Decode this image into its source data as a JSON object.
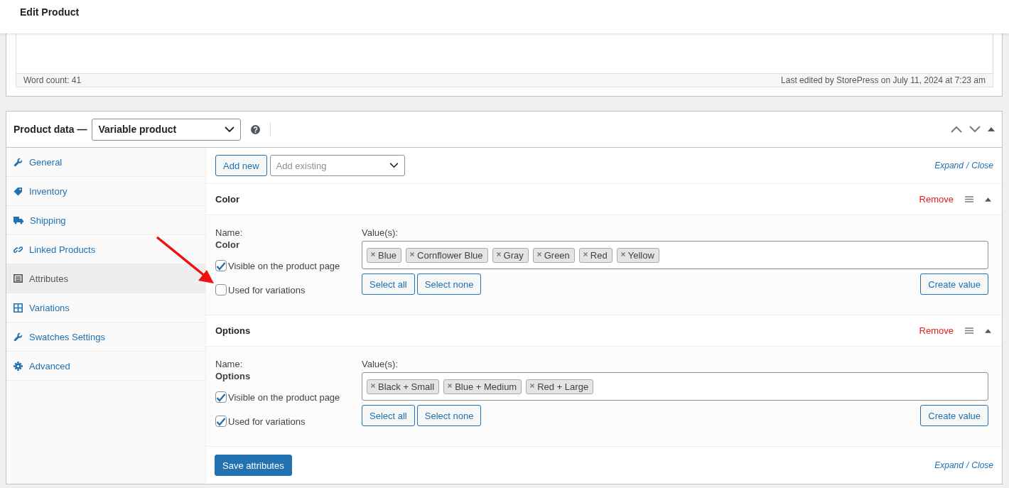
{
  "header": {
    "title": "Edit Product"
  },
  "editor": {
    "word_count": "Word count: 41",
    "last_edited": "Last edited by StorePress on July 11, 2024 at 7:23 am"
  },
  "product_data": {
    "label": "Product data —",
    "type_select": "Variable product",
    "tabs": [
      {
        "label": "General",
        "kind": "wrench",
        "selected": false
      },
      {
        "label": "Inventory",
        "kind": "tag",
        "selected": false
      },
      {
        "label": "Shipping",
        "kind": "truck",
        "selected": false
      },
      {
        "label": "Linked Products",
        "kind": "link",
        "selected": false
      },
      {
        "label": "Attributes",
        "kind": "list",
        "selected": true
      },
      {
        "label": "Variations",
        "kind": "grid",
        "selected": false
      },
      {
        "label": "Swatches Settings",
        "kind": "wrench",
        "selected": false
      },
      {
        "label": "Advanced",
        "kind": "gear",
        "selected": false
      }
    ]
  },
  "toolbar": {
    "add_new": "Add new",
    "add_existing": {
      "placeholder": "Add existing"
    },
    "expand": "Expand",
    "separator": "/",
    "close": "Close"
  },
  "attributes": [
    {
      "title": "Color",
      "remove": "Remove",
      "name_label": "Name:",
      "name": "Color",
      "values_label": "Value(s):",
      "values": [
        "Blue",
        "Cornflower Blue",
        "Gray",
        "Green",
        "Red",
        "Yellow"
      ],
      "visible": {
        "label": "Visible on the product page",
        "checked": true
      },
      "used": {
        "label": "Used for variations",
        "checked": false
      },
      "select_all": "Select all",
      "select_none": "Select none",
      "create_value": "Create value"
    },
    {
      "title": "Options",
      "remove": "Remove",
      "name_label": "Name:",
      "name": "Options",
      "values_label": "Value(s):",
      "values": [
        "Black + Small",
        "Blue + Medium",
        "Red + Large"
      ],
      "visible": {
        "label": "Visible on the product page",
        "checked": true
      },
      "used": {
        "label": "Used for variations",
        "checked": true
      },
      "select_all": "Select all",
      "select_none": "Select none",
      "create_value": "Create value"
    }
  ],
  "footer": {
    "save": "Save attributes",
    "expand": "Expand",
    "separator": "/",
    "close": "Close"
  }
}
